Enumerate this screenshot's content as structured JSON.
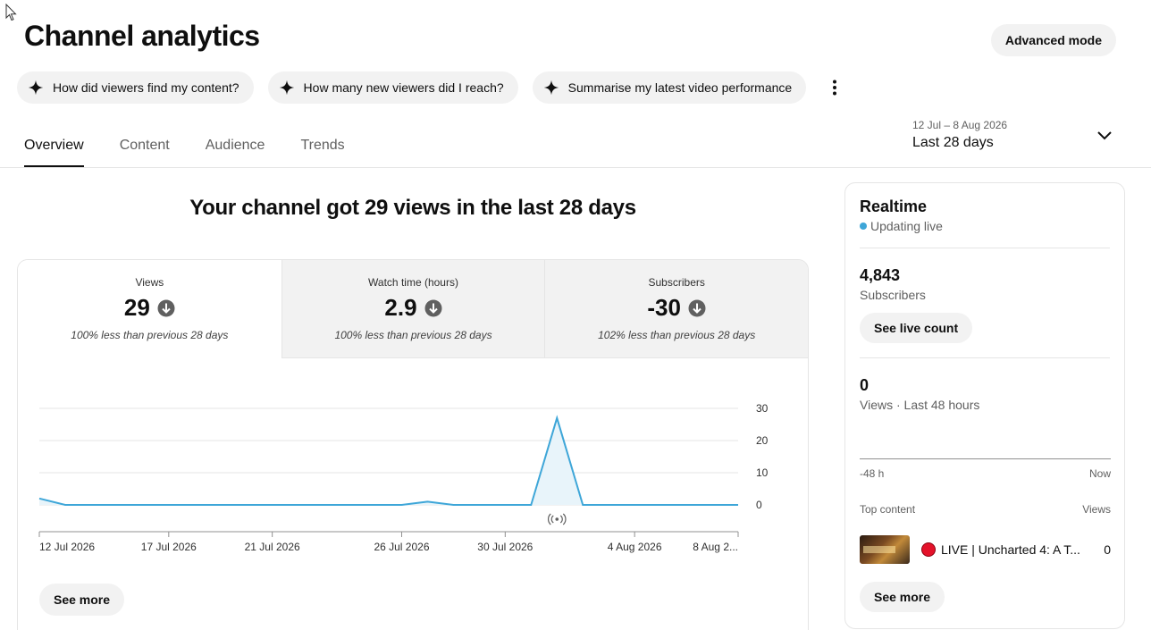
{
  "page": {
    "title": "Channel analytics",
    "advanced_mode_label": "Advanced mode"
  },
  "chips": [
    {
      "label": "How did viewers find my content?",
      "icon": "sparkle-icon"
    },
    {
      "label": "How many new viewers did I reach?",
      "icon": "sparkle-icon"
    },
    {
      "label": "Summarise my latest video performance",
      "icon": "sparkle-icon"
    }
  ],
  "tabs": [
    {
      "label": "Overview",
      "active": true
    },
    {
      "label": "Content",
      "active": false
    },
    {
      "label": "Audience",
      "active": false
    },
    {
      "label": "Trends",
      "active": false
    }
  ],
  "date_range": {
    "range": "12 Jul – 8 Aug 2026",
    "label": "Last 28 days"
  },
  "headline": "Your channel got 29 views in the last 28 days",
  "metrics": [
    {
      "label": "Views",
      "value": "29",
      "note": "100% less than previous 28 days",
      "trend_icon": "arrow-down-icon"
    },
    {
      "label": "Watch time (hours)",
      "value": "2.9",
      "note": "100% less than previous 28 days",
      "trend_icon": "arrow-down-icon"
    },
    {
      "label": "Subscribers",
      "value": "-30",
      "note": "102% less than previous 28 days",
      "trend_icon": "arrow-down-icon"
    }
  ],
  "chart_data": {
    "type": "area",
    "x_tick_labels": [
      "12 Jul 2026",
      "17 Jul 2026",
      "21 Jul 2026",
      "26 Jul 2026",
      "30 Jul 2026",
      "4 Aug 2026",
      "8 Aug 2..."
    ],
    "y_tick_labels": [
      "30",
      "20",
      "10",
      "0"
    ],
    "ylim": [
      0,
      30
    ],
    "series": [
      {
        "values": [
          2,
          0,
          0,
          0,
          0,
          0,
          0,
          0,
          0,
          0,
          0,
          0,
          0,
          0,
          0,
          1,
          0,
          0,
          0,
          0,
          27,
          0,
          0,
          0,
          0,
          0,
          0,
          0
        ]
      }
    ],
    "marker_icon": "live-broadcast-icon",
    "marker_day_index": 20,
    "color": "#3ea6d8",
    "grid": true
  },
  "see_more_label": "See more",
  "realtime": {
    "title": "Realtime",
    "status": "Updating live",
    "subscribers_value": "4,843",
    "subscribers_label": "Subscribers",
    "see_live_count": "See live count",
    "views_value": "0",
    "views_label": "Views · Last 48 hours",
    "axis_start": "-48 h",
    "axis_end": "Now",
    "top_content_label": "Top content",
    "views_col_label": "Views",
    "top_item": {
      "title": "LIVE | Uncharted 4: A T...",
      "views": "0"
    },
    "see_more_label": "See more"
  }
}
